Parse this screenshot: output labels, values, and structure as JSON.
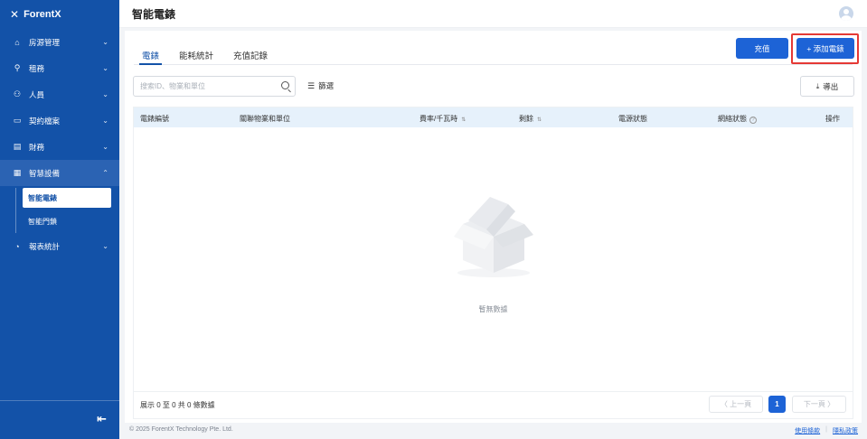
{
  "app": {
    "brand": "ForentX"
  },
  "header": {
    "title": "智能電錶"
  },
  "sidebar": {
    "items": [
      {
        "label": "房源管理",
        "icon": "home-icon"
      },
      {
        "label": "租務",
        "icon": "person-icon"
      },
      {
        "label": "人員",
        "icon": "people-icon"
      },
      {
        "label": "契約檔案",
        "icon": "folder-icon"
      },
      {
        "label": "財務",
        "icon": "document-icon"
      },
      {
        "label": "智慧設備",
        "icon": "device-icon"
      },
      {
        "label": "報表統計",
        "icon": "chart-icon"
      }
    ],
    "sub_items": [
      {
        "label": "智能電錶",
        "active": true
      },
      {
        "label": "智能門鎖",
        "active": false
      }
    ]
  },
  "tabs": [
    {
      "label": "電錶",
      "active": true
    },
    {
      "label": "能耗統計",
      "active": false
    },
    {
      "label": "充值記錄",
      "active": false
    }
  ],
  "toolbar": {
    "recharge_label": "充值",
    "add_label": "+ 添加電錶",
    "search_placeholder": "搜索ID、物業和單位",
    "filter_label": "篩選",
    "export_label": "導出"
  },
  "table": {
    "columns": [
      "電錶編號",
      "關聯物業和單位",
      "費率/千瓦時",
      "剩餘",
      "電源狀態",
      "網絡狀態",
      "操作"
    ],
    "empty_text": "暫無數據",
    "summary": "展示 0 至 0 共 0 條數據"
  },
  "pagination": {
    "prev": "〈 上一頁",
    "current": "1",
    "next": "下一頁 〉"
  },
  "footer": {
    "copyright": "© 2025 ForentX Technology Pte. Ltd.",
    "terms": "使用條款",
    "privacy": "隱私政策"
  },
  "colors": {
    "sidebar": "#1352a8",
    "primary": "#1d63d6",
    "highlight": "#e53935",
    "table_header": "#e6f1fb"
  }
}
